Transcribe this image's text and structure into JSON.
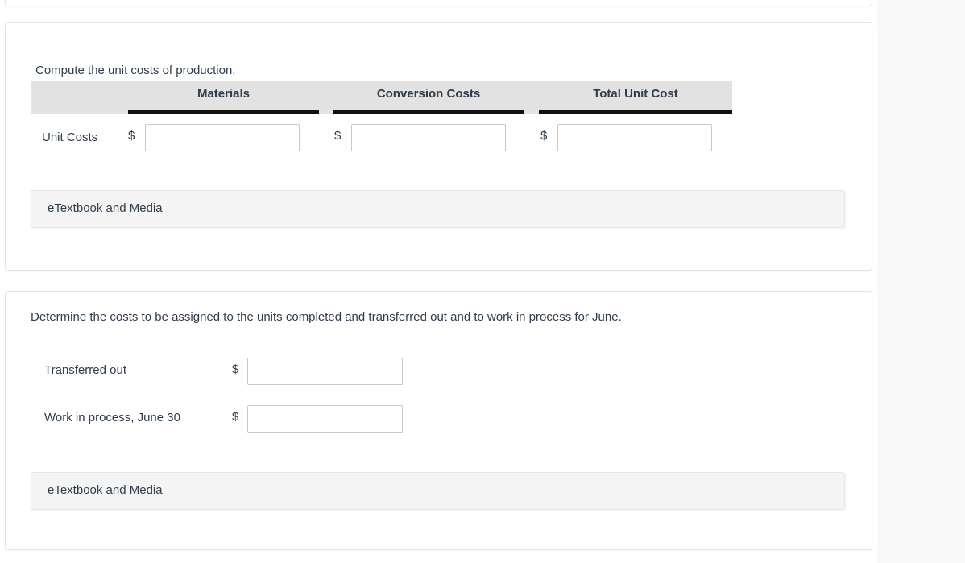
{
  "theme": {
    "page_background": "#f8f8f8",
    "card_background": "#ffffff",
    "card_border": "#e3e3e3",
    "table_header_background": "#e2e2e2",
    "table_rule": "#101010",
    "text_color": "#2f3d4c",
    "input_border": "#c8c8c8",
    "etextbook_background": "#f4f4f4"
  },
  "cards": [
    {
      "prompt": "Compute the unit costs of production.",
      "table": {
        "headers": [
          "",
          "Materials",
          "Conversion Costs",
          "Total Unit Cost"
        ],
        "rows": [
          {
            "label": "Unit Costs",
            "cells": [
              {
                "prefix": "$",
                "value": "",
                "placeholder": ""
              },
              {
                "prefix": "$",
                "value": "",
                "placeholder": ""
              },
              {
                "prefix": "$",
                "value": "",
                "placeholder": ""
              }
            ]
          }
        ]
      },
      "etextbook_label": "eTextbook and Media"
    },
    {
      "prompt": "Determine the costs to be assigned to the units completed and transferred out and to work in process for June.",
      "fields": [
        {
          "label": "Transferred out",
          "prefix": "$",
          "value": "",
          "placeholder": ""
        },
        {
          "label": "Work in process, June 30",
          "prefix": "$",
          "value": "",
          "placeholder": ""
        }
      ],
      "etextbook_label": "eTextbook and Media"
    }
  ]
}
